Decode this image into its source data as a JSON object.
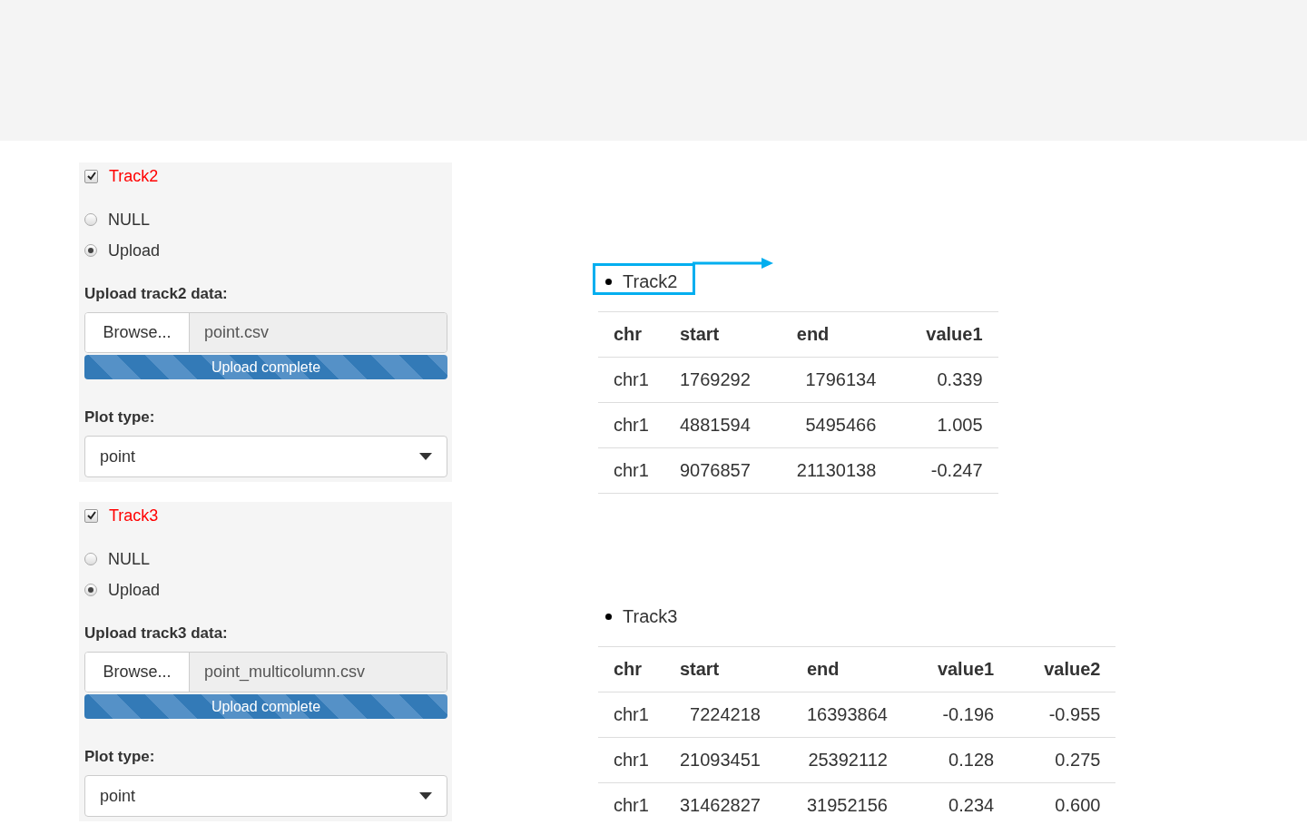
{
  "panels": [
    {
      "track": "Track2",
      "checked": true,
      "radios": [
        {
          "label": "NULL",
          "selected": false
        },
        {
          "label": "Upload",
          "selected": true
        }
      ],
      "upload_label": "Upload track2 data:",
      "browse": "Browse...",
      "file": "point.csv",
      "progress": {
        "text": "Upload complete",
        "level": 1
      },
      "plot_label": "Plot type:",
      "plot_type": "point"
    },
    {
      "track": "Track3",
      "checked": true,
      "radios": [
        {
          "label": "NULL",
          "selected": false
        },
        {
          "label": "Upload",
          "selected": true
        }
      ],
      "upload_label": "Upload track3 data:",
      "browse": "Browse...",
      "file": "point_multicolumn.csv",
      "progress": {
        "text": "Upload complete",
        "level": 1
      },
      "plot_label": "Plot type:",
      "plot_type": "point"
    }
  ],
  "tables": [
    {
      "title": "Track2",
      "highlighted": true,
      "columns": [
        "chr",
        "start",
        "end",
        "value1"
      ],
      "rows": [
        [
          "chr1",
          "1769292",
          "1796134",
          "0.339"
        ],
        [
          "chr1",
          "4881594",
          "5495466",
          "1.005"
        ],
        [
          "chr1",
          "9076857",
          "21130138",
          "-0.247"
        ]
      ]
    },
    {
      "title": "Track3",
      "highlighted": false,
      "columns": [
        "chr",
        "start",
        "end",
        "value1",
        "value2"
      ],
      "rows": [
        [
          "chr1",
          "7224218",
          "16393864",
          "-0.196",
          "-0.955"
        ],
        [
          "chr1",
          "21093451",
          "25392112",
          "0.128",
          "0.275"
        ],
        [
          "chr1",
          "31462827",
          "31952156",
          "0.234",
          "0.600"
        ]
      ]
    }
  ]
}
